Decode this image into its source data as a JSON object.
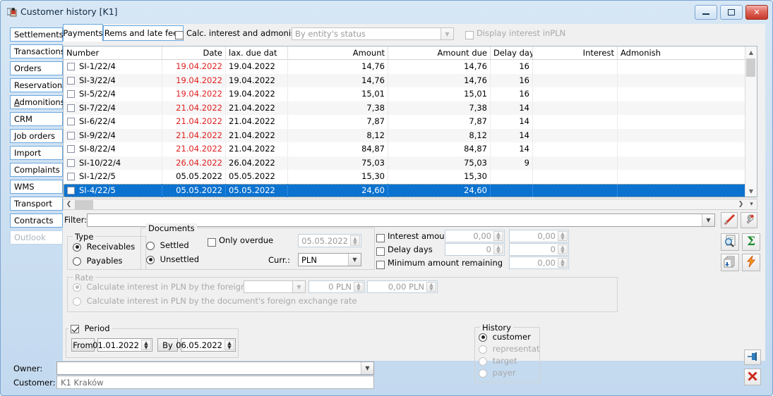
{
  "window": {
    "title": "Customer history [K1]",
    "icon": "window-lock-icon",
    "buttons": {
      "minimize": "minimize-icon",
      "maximize": "maximize-icon",
      "close": "close-icon"
    }
  },
  "sidebar": {
    "items": [
      {
        "label": "Settlements",
        "disabled": false
      },
      {
        "label": "Transactions",
        "disabled": false
      },
      {
        "label": "Orders",
        "disabled": false
      },
      {
        "label": "Reservations",
        "disabled": false
      },
      {
        "label": "Admonitions",
        "disabled": false,
        "accel": "A"
      },
      {
        "label": "CRM",
        "disabled": false
      },
      {
        "label": "Job orders",
        "disabled": false
      },
      {
        "label": "Import",
        "disabled": false
      },
      {
        "label": "Complaints",
        "disabled": false
      },
      {
        "label": "WMS",
        "disabled": false
      },
      {
        "label": "Transport",
        "disabled": false
      },
      {
        "label": "Contracts",
        "disabled": false
      },
      {
        "label": "Outlook",
        "disabled": true
      }
    ]
  },
  "toptabs": {
    "payments": "Payments",
    "rems": "Rems and late fees",
    "calc_admonish_label": "Calc. interest and admonish.",
    "calc_admonish_checked": false,
    "status_combo_value": "By entity's status",
    "status_combo_disabled": true,
    "display_interest_label": "Display interest inPLN",
    "display_interest_checked": false,
    "display_interest_disabled": true
  },
  "grid": {
    "columns": [
      {
        "label": "Number",
        "align": "left"
      },
      {
        "label": "Date",
        "align": "right"
      },
      {
        "label": "lax. due dat",
        "align": "left"
      },
      {
        "label": "Amount",
        "align": "right"
      },
      {
        "label": "Amount due",
        "align": "right"
      },
      {
        "label": "Delay days",
        "align": "right"
      },
      {
        "label": "Interest",
        "align": "right"
      },
      {
        "label": "Admonish",
        "align": "left"
      }
    ],
    "rows": [
      {
        "number": "SI-1/22/4",
        "date": "19.04.2022",
        "date_overdue": true,
        "max_due": "19.04.2022",
        "amount": "14,76",
        "amount_due": "14,76",
        "delay": "16",
        "interest": "",
        "admonish": "",
        "selected": false
      },
      {
        "number": "SI-3/22/4",
        "date": "19.04.2022",
        "date_overdue": true,
        "max_due": "19.04.2022",
        "amount": "14,76",
        "amount_due": "14,76",
        "delay": "16",
        "interest": "",
        "admonish": "",
        "selected": false
      },
      {
        "number": "SI-5/22/4",
        "date": "19.04.2022",
        "date_overdue": true,
        "max_due": "19.04.2022",
        "amount": "15,01",
        "amount_due": "15,01",
        "delay": "16",
        "interest": "",
        "admonish": "",
        "selected": false
      },
      {
        "number": "SI-7/22/4",
        "date": "21.04.2022",
        "date_overdue": true,
        "max_due": "21.04.2022",
        "amount": "7,38",
        "amount_due": "7,38",
        "delay": "14",
        "interest": "",
        "admonish": "",
        "selected": false
      },
      {
        "number": "SI-6/22/4",
        "date": "21.04.2022",
        "date_overdue": true,
        "max_due": "21.04.2022",
        "amount": "7,87",
        "amount_due": "7,87",
        "delay": "14",
        "interest": "",
        "admonish": "",
        "selected": false
      },
      {
        "number": "SI-9/22/4",
        "date": "21.04.2022",
        "date_overdue": true,
        "max_due": "21.04.2022",
        "amount": "8,12",
        "amount_due": "8,12",
        "delay": "14",
        "interest": "",
        "admonish": "",
        "selected": false
      },
      {
        "number": "SI-8/22/4",
        "date": "21.04.2022",
        "date_overdue": true,
        "max_due": "21.04.2022",
        "amount": "84,87",
        "amount_due": "84,87",
        "delay": "14",
        "interest": "",
        "admonish": "",
        "selected": false
      },
      {
        "number": "SI-10/22/4",
        "date": "26.04.2022",
        "date_overdue": true,
        "max_due": "26.04.2022",
        "amount": "75,03",
        "amount_due": "75,03",
        "delay": "9",
        "interest": "",
        "admonish": "",
        "selected": false
      },
      {
        "number": "SI-1/22/5",
        "date": "05.05.2022",
        "date_overdue": false,
        "max_due": "05.05.2022",
        "amount": "15,30",
        "amount_due": "15,30",
        "delay": "",
        "interest": "",
        "admonish": "",
        "selected": false
      },
      {
        "number": "SI-4/22/5",
        "date": "05.05.2022",
        "date_overdue": false,
        "max_due": "05.05.2022",
        "amount": "24,60",
        "amount_due": "24,60",
        "delay": "",
        "interest": "",
        "admonish": "",
        "selected": true
      }
    ]
  },
  "filter": {
    "label": "Filter:",
    "value": "",
    "clear_icon": "red-pen-icon",
    "settings_icon": "wrench-icon"
  },
  "type_group": {
    "title": "Type",
    "receivables": "Receivables",
    "payables": "Payables",
    "selected": "Receivables"
  },
  "documents_group": {
    "title": "Documents",
    "settled": "Settled",
    "unsettled": "Unsettled",
    "selected": "Unsettled",
    "only_overdue_label": "Only overdue",
    "only_overdue_checked": false,
    "only_overdue_date": "05.05.2022",
    "currency_label": "Curr.:",
    "currency_value": "PLN"
  },
  "conditions": {
    "interest_amount_label": "Interest amoun",
    "interest_amount_checked": false,
    "interest_amount_from": "0,00",
    "interest_amount_to": "0,00",
    "delay_days_label": "Delay days",
    "delay_days_checked": false,
    "delay_days_from": "0",
    "delay_days_to": "0",
    "minimum_remaining_label": "Minimum amount remaining",
    "minimum_remaining_checked": false,
    "minimum_remaining_value": "0,00"
  },
  "rate_group": {
    "title": "Rate",
    "option1": "Calculate interest in PLN by the foreign exchan",
    "option2": "Calculate interest in PLN by the document's foreign exchange rate",
    "selected": "option1",
    "combo_value": "",
    "value1": "0 PLN",
    "value2": "0,00 PLN"
  },
  "period_group": {
    "title": "Period",
    "checked": true,
    "from_label": "From",
    "from_value": "01.01.2022",
    "by_label": "By",
    "by_value": "06.05.2022"
  },
  "history_group": {
    "title": "History",
    "options": [
      {
        "label": "customer",
        "disabled": false,
        "selected": true
      },
      {
        "label": "representative",
        "disabled": true,
        "selected": false
      },
      {
        "label": "target",
        "disabled": true,
        "selected": false
      },
      {
        "label": "payer",
        "disabled": true,
        "selected": false
      }
    ]
  },
  "bottom": {
    "owner_label": "Owner:",
    "owner_value": "",
    "customer_label": "Customer:",
    "customer_value": "K1 Kraków"
  },
  "toolbar": {
    "search_icon": "magnifier-document-icon",
    "sum_icon": "sigma-sum-icon",
    "copy_icon": "pages-copy-icon",
    "lightning_icon": "lightning-bolt-icon",
    "pin_icon": "pin-icon",
    "cancel_icon": "red-x-icon"
  },
  "colors": {
    "accent": "#0b72d0",
    "overdue": "#e02020",
    "frame": "#7ba4d0",
    "tab_border": "#6aa8e0",
    "disabled_text": "#a9a9a9"
  }
}
